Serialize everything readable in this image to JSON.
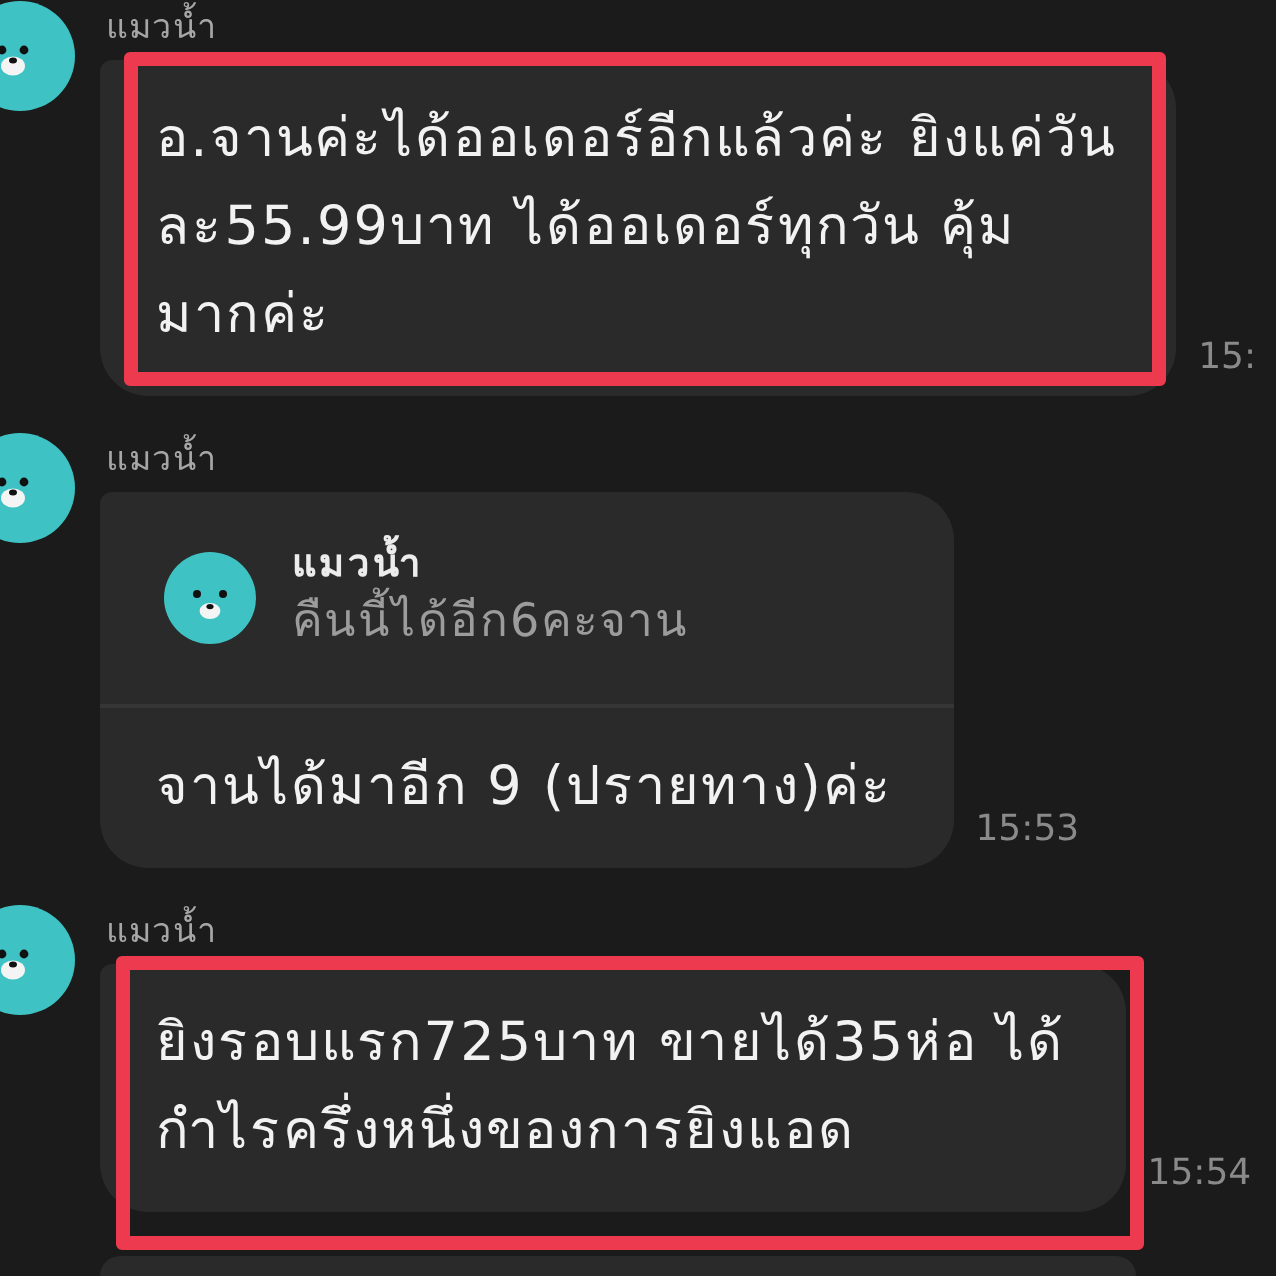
{
  "messages": [
    {
      "sender": "แมวน้ำ",
      "highlighted": true,
      "lines": [
        "อ.จานค่ะได้ออเดอร์อีกแล้วค่ะ ยิงแค่วัน",
        "ละ55.99บาท ได้ออเดอร์ทุกวัน คุ้ม",
        "มากค่ะ"
      ],
      "time": "15:"
    },
    {
      "sender": "แมวน้ำ",
      "highlighted": false,
      "reply": {
        "sender": "แมวน้ำ",
        "text": "คืนนี้ได้อีก6คะจาน"
      },
      "lines": [
        "จานได้มาอีก 9 (ปรายทาง)ค่ะ"
      ],
      "time": "15:53"
    },
    {
      "sender": "แมวน้ำ",
      "highlighted": true,
      "lines": [
        "ยิงรอบแรก725บาท ขายได้35ห่อ ได้",
        "กำไรครึ่งหนึ่งของการยิงแอด"
      ],
      "time": "15:54"
    }
  ]
}
